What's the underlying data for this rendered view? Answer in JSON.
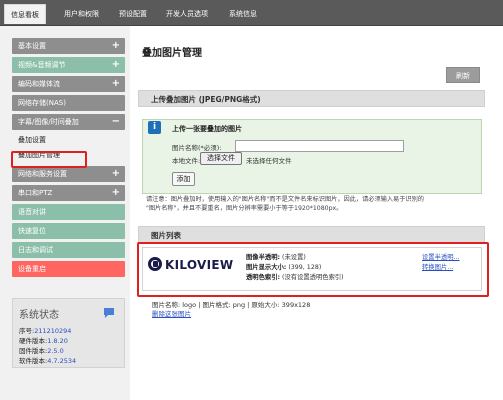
{
  "nav": {
    "tabs": [
      "信息看板",
      "用户和权限",
      "预设配置",
      "开发人员选项",
      "系统信息"
    ],
    "active": 0
  },
  "sidebar": {
    "items": [
      {
        "label": "基本设置",
        "sign": "+",
        "style": "gray"
      },
      {
        "label": "视频&音频调节",
        "sign": "+",
        "style": "green"
      },
      {
        "label": "编码和媒体流",
        "sign": "+",
        "style": "gray"
      },
      {
        "label": "网络存储(NAS)",
        "sign": "",
        "style": "gray"
      },
      {
        "label": "字幕/图像/时间叠加",
        "sign": "−",
        "style": "gray"
      },
      {
        "label": "网络和服务设置",
        "sign": "+",
        "style": "gray"
      },
      {
        "label": "串口和PTZ",
        "sign": "+",
        "style": "gray"
      },
      {
        "label": "语音对讲",
        "sign": "",
        "style": "green"
      },
      {
        "label": "快速复位",
        "sign": "",
        "style": "green"
      },
      {
        "label": "日志和调试",
        "sign": "",
        "style": "green"
      },
      {
        "label": "设备重启",
        "sign": "",
        "style": "red"
      }
    ],
    "subitems": [
      "叠加设置",
      "叠加图片管理"
    ]
  },
  "status": {
    "title": "系统状态",
    "rows": [
      {
        "k": "序号:",
        "v": "211210294"
      },
      {
        "k": "硬件版本:",
        "v": "1.8.20"
      },
      {
        "k": "固件版本:",
        "v": "2.5.0"
      },
      {
        "k": "软件版本:",
        "v": "4.7.2534"
      }
    ]
  },
  "page": {
    "title": "叠加图片管理",
    "refresh_label": "刷新",
    "upload_header": "上传叠加图片 (JPEG/PNG格式)",
    "info_title": "上传一张要叠加的图片",
    "name_label": "图片名称(*必须):",
    "file_label": "本地文件:",
    "file_button": "选择文件",
    "file_status": "未选择任何文件",
    "add_button": "添加",
    "note_line1": "请注意：图片叠加时，使用输入的\"图片名称\"而不是文件名来标识图片，因此，请必须输入易于识别的",
    "note_line2": "\"图片名称\"，并且不要重名，图片分辨率需要小于等于1920*1080px。",
    "list_header": "图片列表"
  },
  "image_card": {
    "logo_text": "KILOVIEW",
    "alpha_label": "图像半透明:",
    "alpha_value": "(未设置)",
    "size_label": "图片显示大小:",
    "size_value": "(399, 128)",
    "key_label": "透明色索引:",
    "key_value": "(没有设置透明色索引)",
    "link_alpha": "设置半透明...",
    "link_convert": "转换图片...",
    "meta": "图片名称: logo | 图片格式: png | 原始大小: 399x128",
    "delete_link": "删除这张图片"
  }
}
